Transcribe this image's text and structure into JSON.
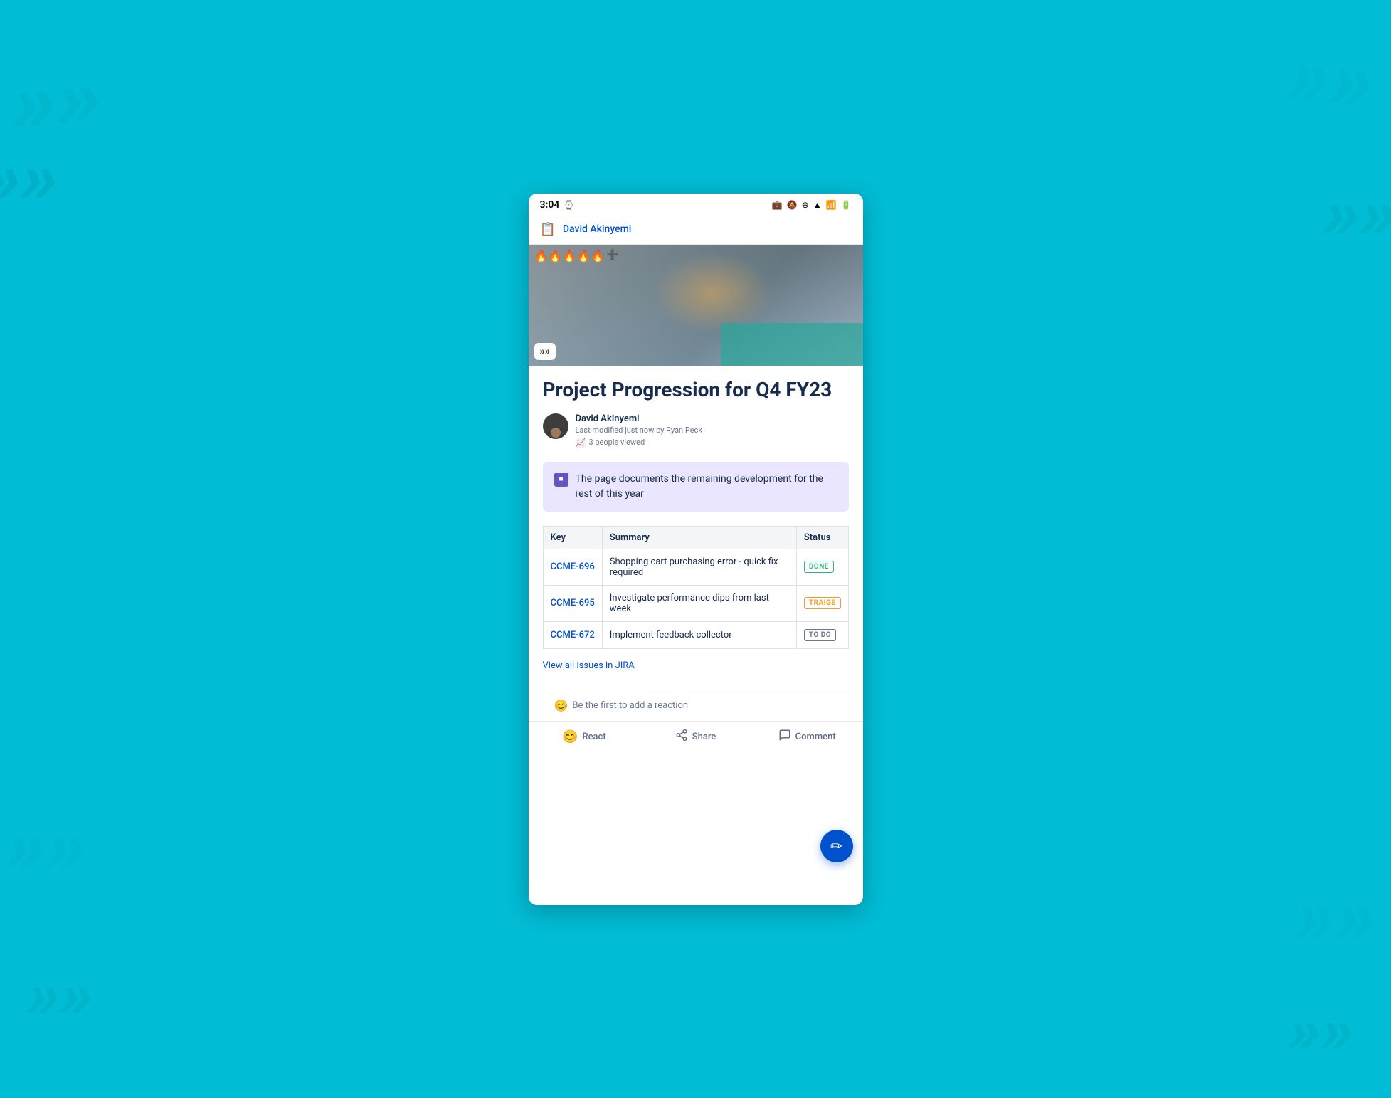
{
  "statusBar": {
    "time": "3:04",
    "icons": [
      "briefcase",
      "bell-off",
      "circle",
      "wifi",
      "signal",
      "battery"
    ]
  },
  "topNav": {
    "icon": "📋",
    "title": "David Akinyemi"
  },
  "page": {
    "title": "Project Progression for Q4 FY23",
    "author": {
      "name": "David Akinyemi",
      "subtitle": "Last modified just now by Ryan Peck",
      "views": "3 people viewed"
    },
    "summary": "The page documents the remaining development for the rest of this year",
    "summaryIcon": "■"
  },
  "table": {
    "headers": [
      "Key",
      "Summary",
      "Status"
    ],
    "rows": [
      {
        "key": "CCME-696",
        "summary": "Shopping cart purchasing error - quick fix required",
        "status": "DONE",
        "statusType": "done"
      },
      {
        "key": "CCME-695",
        "summary": "Investigate performance dips from last week",
        "status": "TRAIGE",
        "statusType": "traige"
      },
      {
        "key": "CCME-672",
        "summary": "Implement feedback collector",
        "status": "TO DO",
        "statusType": "todo"
      }
    ],
    "viewAllLink": "View all issues in JIRA"
  },
  "reaction": {
    "prompt": "Be the first to add a reaction"
  },
  "fab": {
    "label": "✏"
  },
  "bottomBar": {
    "actions": [
      {
        "icon": "😊",
        "label": "React"
      },
      {
        "icon": "↗",
        "label": "Share"
      },
      {
        "icon": "💬",
        "label": "Comment"
      }
    ]
  }
}
